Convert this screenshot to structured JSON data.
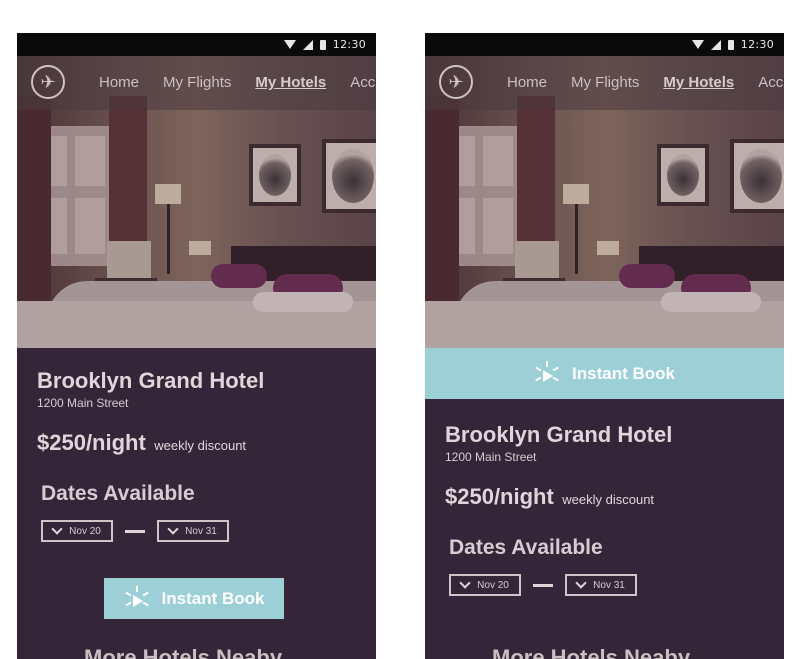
{
  "status": {
    "time": "12:30"
  },
  "nav": {
    "items": [
      {
        "label": "Home"
      },
      {
        "label": "My Flights"
      },
      {
        "label": "My Hotels",
        "active": true
      },
      {
        "label": "Acc"
      }
    ]
  },
  "hotel": {
    "name": "Brooklyn Grand Hotel",
    "address": "1200 Main Street",
    "price": "$250/night",
    "discount": "weekly discount"
  },
  "dates": {
    "title": "Dates Available",
    "start": "Nov 20",
    "end": "Nov 31"
  },
  "book": {
    "label": "Instant Book"
  },
  "more": {
    "label": "More Hotels Neaby"
  },
  "colors": {
    "background": "#352539",
    "accent": "#9ccfd6",
    "status_bar": "#0a0a0a"
  }
}
